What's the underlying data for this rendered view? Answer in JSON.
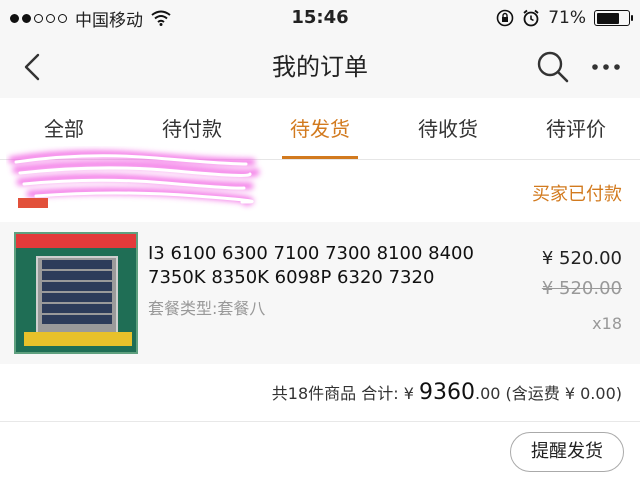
{
  "status_bar": {
    "carrier": "中国移动",
    "time": "15:46",
    "battery_percent": "71%",
    "battery_level": 0.71,
    "signal_bars_filled": 2,
    "signal_bars_total": 5
  },
  "nav": {
    "title": "我的订单"
  },
  "tabs": [
    {
      "label": "全部"
    },
    {
      "label": "待付款"
    },
    {
      "label": "待发货"
    },
    {
      "label": "待收货"
    },
    {
      "label": "待评价"
    }
  ],
  "active_tab": "待发货",
  "order": {
    "status": "买家已付款",
    "item": {
      "title": "I3 6100 6300 7100 7300 8100 8400 7350K 8350K 6098P 6320 7320",
      "variant": "套餐类型:套餐八",
      "price": "¥ 520.00",
      "original_price": "¥ 520.00",
      "quantity": "x18"
    },
    "summary": {
      "count_text": "共18件商品 合计:",
      "currency": "¥",
      "total_main": "9360",
      "total_decimal": ".00",
      "shipping": "(含运费 ¥ 0.00)"
    },
    "action_label": "提醒发货"
  },
  "colors": {
    "accent": "#d27a1e"
  }
}
